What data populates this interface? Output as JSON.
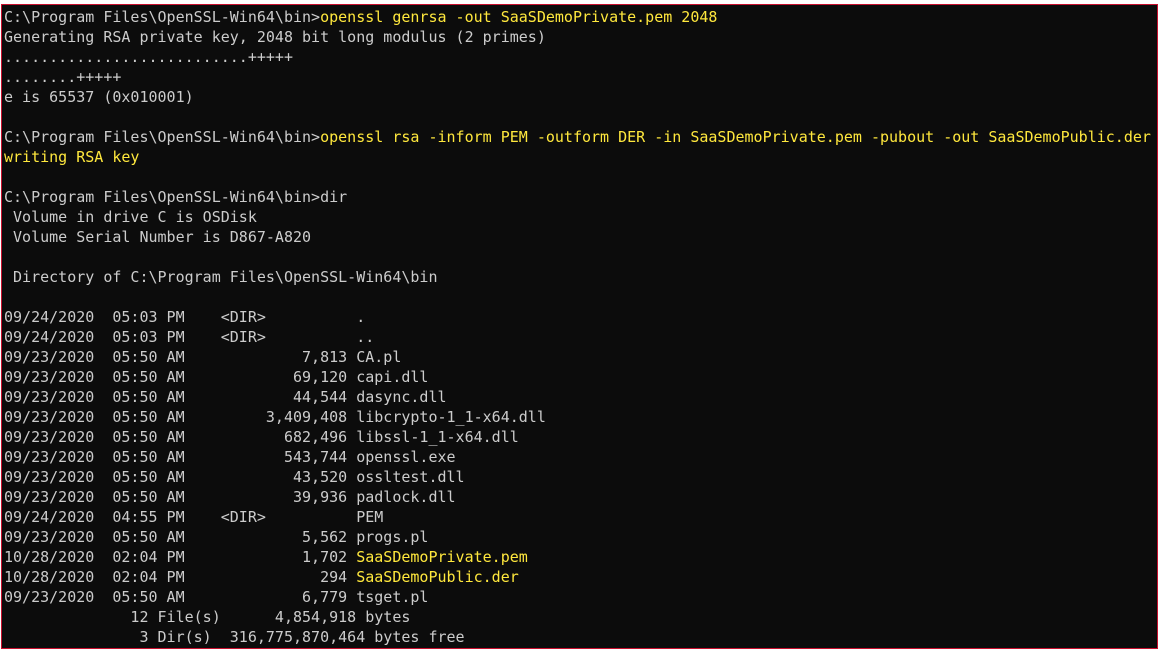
{
  "colors": {
    "background": "#0c0c0c",
    "text": "#cccccc",
    "highlight": "#ffe83d",
    "frame": "#c8102e"
  },
  "terminal": {
    "lines": [
      [
        {
          "t": "C:\\Program Files\\OpenSSL-Win64\\bin>",
          "c": "w"
        },
        {
          "t": "openssl genrsa -out SaaSDemoPrivate.pem 2048",
          "c": "y"
        }
      ],
      [
        {
          "t": "Generating RSA private key, 2048 bit long modulus (2 primes)",
          "c": "w"
        }
      ],
      [
        {
          "t": "...........................+++++",
          "c": "w"
        }
      ],
      [
        {
          "t": "........+++++",
          "c": "w"
        }
      ],
      [
        {
          "t": "e is 65537 (0x010001)",
          "c": "w"
        }
      ],
      [],
      [
        {
          "t": "C:\\Program Files\\OpenSSL-Win64\\bin>",
          "c": "w"
        },
        {
          "t": "openssl rsa -inform PEM -outform DER -in SaaSDemoPrivate.pem -pubout -out SaaSDemoPublic.der",
          "c": "y"
        }
      ],
      [
        {
          "t": "writing RSA key",
          "c": "y"
        }
      ],
      [],
      [
        {
          "t": "C:\\Program Files\\OpenSSL-Win64\\bin>dir",
          "c": "w"
        }
      ],
      [
        {
          "t": " Volume in drive C is OSDisk",
          "c": "w"
        }
      ],
      [
        {
          "t": " Volume Serial Number is D867-A820",
          "c": "w"
        }
      ],
      [],
      [
        {
          "t": " Directory of C:\\Program Files\\OpenSSL-Win64\\bin",
          "c": "w"
        }
      ],
      [],
      [
        {
          "t": "09/24/2020  05:03 PM    <DIR>          .",
          "c": "w"
        }
      ],
      [
        {
          "t": "09/24/2020  05:03 PM    <DIR>          ..",
          "c": "w"
        }
      ],
      [
        {
          "t": "09/23/2020  05:50 AM             7,813 CA.pl",
          "c": "w"
        }
      ],
      [
        {
          "t": "09/23/2020  05:50 AM            69,120 capi.dll",
          "c": "w"
        }
      ],
      [
        {
          "t": "09/23/2020  05:50 AM            44,544 dasync.dll",
          "c": "w"
        }
      ],
      [
        {
          "t": "09/23/2020  05:50 AM         3,409,408 libcrypto-1_1-x64.dll",
          "c": "w"
        }
      ],
      [
        {
          "t": "09/23/2020  05:50 AM           682,496 libssl-1_1-x64.dll",
          "c": "w"
        }
      ],
      [
        {
          "t": "09/23/2020  05:50 AM           543,744 openssl.exe",
          "c": "w"
        }
      ],
      [
        {
          "t": "09/23/2020  05:50 AM            43,520 ossltest.dll",
          "c": "w"
        }
      ],
      [
        {
          "t": "09/23/2020  05:50 AM            39,936 padlock.dll",
          "c": "w"
        }
      ],
      [
        {
          "t": "09/24/2020  04:55 PM    <DIR>          PEM",
          "c": "w"
        }
      ],
      [
        {
          "t": "09/23/2020  05:50 AM             5,562 progs.pl",
          "c": "w"
        }
      ],
      [
        {
          "t": "10/28/2020  02:04 PM             1,702 ",
          "c": "w"
        },
        {
          "t": "SaaSDemoPrivate.pem",
          "c": "y"
        }
      ],
      [
        {
          "t": "10/28/2020  02:04 PM               294 ",
          "c": "w"
        },
        {
          "t": "SaaSDemoPublic.der",
          "c": "y"
        }
      ],
      [
        {
          "t": "09/23/2020  05:50 AM             6,779 tsget.pl",
          "c": "w"
        }
      ],
      [
        {
          "t": "              12 File(s)      4,854,918 bytes",
          "c": "w"
        }
      ],
      [
        {
          "t": "               3 Dir(s)  316,775,870,464 bytes free",
          "c": "w"
        }
      ]
    ]
  }
}
